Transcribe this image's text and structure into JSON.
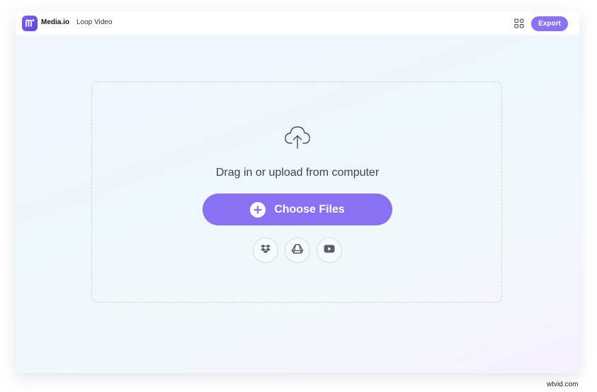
{
  "header": {
    "brand": "Media.io",
    "page_name": "Loop Video",
    "export_label": "Export",
    "icons": [
      "logo-icon",
      "apps-grid-icon"
    ]
  },
  "upload": {
    "prompt": "Drag in or upload from computer",
    "choose_label": "Choose Files",
    "sources": [
      {
        "name": "dropbox",
        "icon": "dropbox-icon"
      },
      {
        "name": "google-drive",
        "icon": "google-drive-icon"
      },
      {
        "name": "youtube",
        "icon": "youtube-icon"
      }
    ]
  },
  "watermark": "wtvid.com",
  "colors": {
    "accent": "#8a71f3",
    "logo": "#6a50ef",
    "text": "#3f4350"
  }
}
